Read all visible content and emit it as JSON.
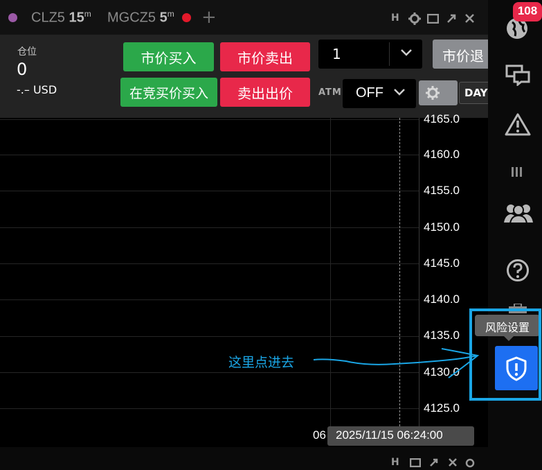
{
  "tabs": [
    {
      "symbol": "CLZ5",
      "interval": "15",
      "unit": "m"
    },
    {
      "symbol": "MGCZ5",
      "interval": "5",
      "unit": "m"
    }
  ],
  "tab_add": "+",
  "window_ctl_h": "H",
  "order": {
    "position_label": "仓位",
    "position_value": "0",
    "position_pnl": "-.– USD",
    "buy_market": "市价买入",
    "sell_market": "市价卖出",
    "buy_bid": "在竞买价买入",
    "sell_ask": "卖出出价",
    "quantity": "1",
    "exit_market": "市价退",
    "atm_label": "ATM",
    "atm_value": "OFF",
    "tif": "DAY"
  },
  "chart_data": {
    "type": "line",
    "y_ticks": [
      "4165.0",
      "4160.0",
      "4155.0",
      "4150.0",
      "4145.0",
      "4140.0",
      "4135.0",
      "4130.0",
      "4125.0"
    ],
    "x_tick_partial": "06",
    "crosshair_label": "2025/11/15 06:24:00"
  },
  "sidebar": {
    "badge": "108",
    "tooltip": "风险设置",
    "icons": [
      "globe-icon",
      "chat-icon",
      "warning-icon",
      "bars-icon",
      "people-icon",
      "help-icon",
      "briefcase-icon",
      "shield-alert-icon"
    ]
  },
  "annotation": {
    "text": "这里点进去",
    "color": "#1aa6e6"
  },
  "colors": {
    "buy": "#2ba84a",
    "sell": "#e8284a",
    "accent": "#1d6ff2",
    "tab_dot_1": "#9b59a6",
    "tab_dot_2": "#e3192a"
  }
}
